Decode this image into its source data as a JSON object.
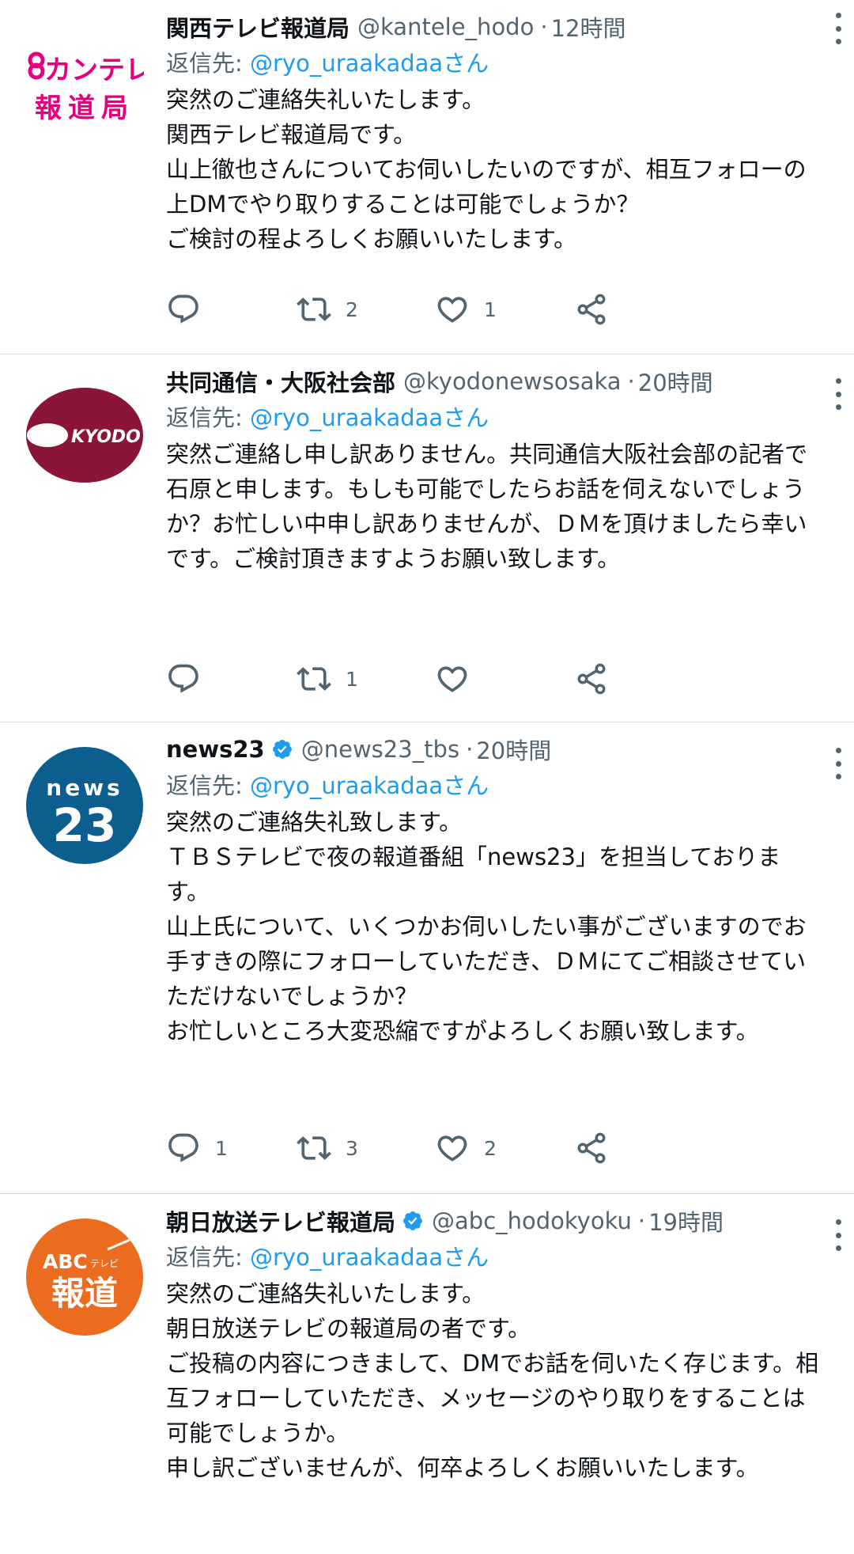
{
  "tweets": [
    {
      "avatar_text_top": "カンテレ",
      "avatar_text_bottom": "報道局",
      "display_name": "関西テレビ報道局",
      "verified": false,
      "handle": "@kantele_hodo",
      "time": "12時間",
      "reply_prefix": "返信先: ",
      "reply_mention": "@ryo_uraakadaaさん",
      "text": "突然のご連絡失礼いたします。\n関西テレビ報道局です。\n山上徹也さんについてお伺いしたいのですが、相互フォローの上DMでやり取りすることは可能でしょうか？\nご検討の程よろしくお願いいたします。",
      "reply_count": "",
      "retweet_count": "2",
      "like_count": "1"
    },
    {
      "avatar_text": "KYODO",
      "display_name": "共同通信・大阪社会部",
      "verified": false,
      "handle": "@kyodonewsosaka",
      "time": "20時間",
      "reply_prefix": "返信先: ",
      "reply_mention": "@ryo_uraakadaaさん",
      "text": "突然ご連絡し申し訳ありません。共同通信大阪社会部の記者で石原と申します。もしも可能でしたらお話を伺えないでしょうか？お忙しい中申し訳ありませんが、ＤＭを頂けましたら幸いです。ご検討頂きますようお願い致します。",
      "reply_count": "",
      "retweet_count": "1",
      "like_count": ""
    },
    {
      "avatar_text_top": "news",
      "avatar_text_bottom": "23",
      "display_name": "news23",
      "verified": true,
      "handle": "@news23_tbs",
      "time": "20時間",
      "reply_prefix": "返信先: ",
      "reply_mention": "@ryo_uraakadaaさん",
      "text": "突然のご連絡失礼致します。\nＴＢＳテレビで夜の報道番組「news23」を担当しております。\n山上氏について、いくつかお伺いしたい事がございますのでお手すきの際にフォローしていただき、ＤＭにてご相談させていただけないでしょうか？\nお忙しいところ大変恐縮ですがよろしくお願い致します。",
      "reply_count": "1",
      "retweet_count": "3",
      "like_count": "2"
    },
    {
      "avatar_text_top": "ABC",
      "avatar_text_small": "テレビ",
      "avatar_text_bottom": "報道",
      "display_name": "朝日放送テレビ報道局",
      "verified": true,
      "handle": "@abc_hodokyoku",
      "time": "19時間",
      "reply_prefix": "返信先: ",
      "reply_mention": "@ryo_uraakadaaさん",
      "text": "突然のご連絡失礼いたします。\n朝日放送テレビの報道局の者です。\nご投稿の内容につきまして、DMでお話を伺いたく存じます。相互フォローしていただき、メッセージのやり取りをすることは可能でしょうか。\n申し訳ございませんが、何卒よろしくお願いいたします。",
      "reply_count": "",
      "retweet_count": "",
      "like_count": ""
    }
  ],
  "colors": {
    "kantele_pink": "#e5007f",
    "kyodo_maroon": "#8b1537",
    "news23_blue": "#0b5e8e",
    "abc_orange": "#ec6c1f",
    "verified_blue": "#1d9bf0",
    "mention_blue": "#1d9bf0",
    "secondary_text": "#536471"
  }
}
